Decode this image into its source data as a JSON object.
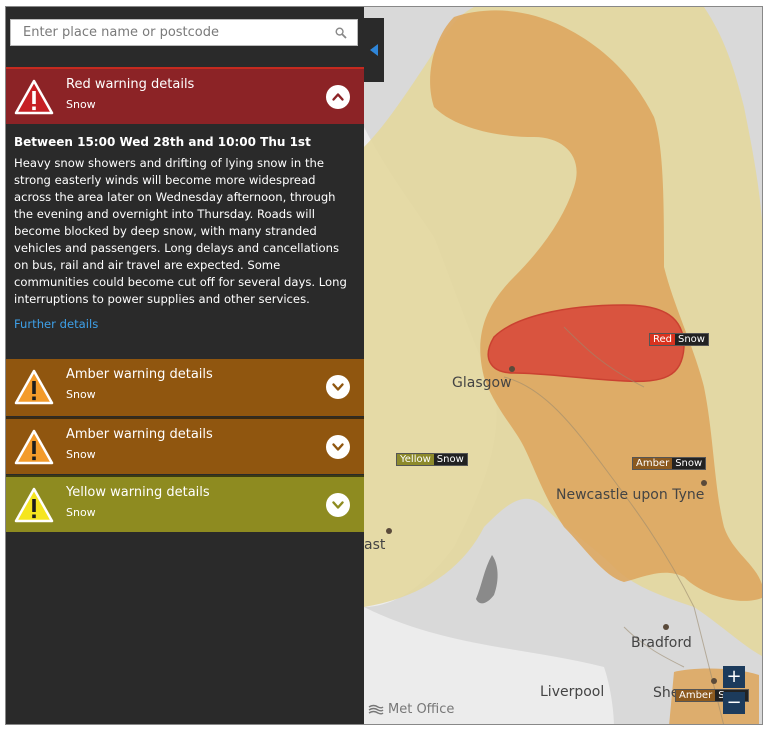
{
  "search": {
    "placeholder": "Enter place name or postcode",
    "icon": "search-icon"
  },
  "warnings": [
    {
      "id": "red",
      "title": "Red warning details",
      "type": "Snow",
      "color": "#8c2326",
      "expanded": true
    },
    {
      "id": "amber1",
      "title": "Amber warning details",
      "type": "Snow",
      "color": "#90560f",
      "expanded": false
    },
    {
      "id": "amber2",
      "title": "Amber warning details",
      "type": "Snow",
      "color": "#90560f",
      "expanded": false
    },
    {
      "id": "yellow",
      "title": "Yellow warning details",
      "type": "Snow",
      "color": "#8e8b20",
      "expanded": false
    }
  ],
  "details": {
    "period": "Between 15:00 Wed 28th and 10:00 Thu 1st",
    "description": "Heavy snow showers and drifting of lying snow in the strong easterly winds will become more widespread across the area later on Wednesday afternoon, through the evening and overnight into Thursday. Roads will become blocked by deep snow, with many stranded vehicles and passengers. Long delays and cancellations on bus, rail and air travel are expected. Some communities could become cut off for several days. Long interruptions to power supplies and other services.",
    "further_link": "Further details"
  },
  "map": {
    "places": {
      "glasgow": "Glasgow",
      "newcastle": "Newcastle upon Tyne",
      "bradford": "Bradford",
      "liverpool": "Liverpool",
      "sheffield_partial": "She",
      "belfast_partial": "ast"
    },
    "labels": {
      "red": {
        "level": "Red",
        "type": "Snow"
      },
      "amber_ne": {
        "level": "Amber",
        "type": "Snow"
      },
      "yellow_w": {
        "level": "Yellow",
        "type": "Snow"
      },
      "amber_se": {
        "level": "Amber",
        "type": "Snow"
      }
    },
    "zoom_in": "+",
    "zoom_out": "−",
    "attribution": "Met Office"
  },
  "colors": {
    "red_zone": "#d9493a",
    "amber_zone": "#deaa5f",
    "yellow_zone": "#e4d79a",
    "link": "#3ea0e8",
    "zoom_button": "#1c3b5c"
  }
}
